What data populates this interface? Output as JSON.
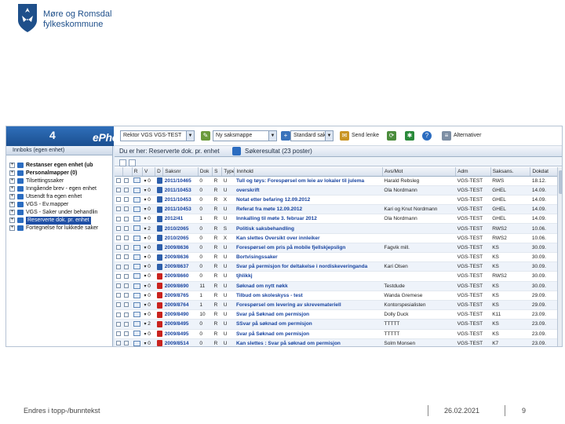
{
  "logo": {
    "line1": "Møre og Romsdal",
    "line2": "fylkeskommune",
    "shield_color": "#1e4f8a"
  },
  "app": {
    "brand": "ePhorte",
    "brand_version": "4",
    "role_value": "Rektor VGS VGS-TEST",
    "folder_value": "Ny saksmappe",
    "template_value": "Standard sak",
    "send_link_label": "Send lenke",
    "alternatives_label": "Alternativer"
  },
  "left_pane": {
    "header": "Innboks (egen enhet)",
    "items": [
      {
        "label": "Restanser egen enhet (ub",
        "bold": true
      },
      {
        "label": "Personalmapper (0)",
        "bold": true
      },
      {
        "label": "Tilsettingssaker",
        "bold": false
      },
      {
        "label": "Inngående brev - egen enhet",
        "bold": false
      },
      {
        "label": "Utsendt fra egen enhet",
        "bold": false
      },
      {
        "label": "VGS - Ev.mapper",
        "bold": false
      },
      {
        "label": "VGS - Saker under behandlin",
        "bold": false
      },
      {
        "label": "Reserverte dok. pr. enhet",
        "bold": false,
        "selected": true
      },
      {
        "label": "Fortegnelse for lukkede saker",
        "bold": false
      }
    ]
  },
  "right_pane": {
    "breadcrumb": "Du er her: Reserverte dok. pr. enhet",
    "search_result": "Søkeresultat (23 poster)",
    "columns": [
      "",
      "",
      "R",
      "V",
      "D",
      "Saksnr",
      "Dok",
      "S",
      "Type",
      "Innhold",
      "Avs/Mot",
      "Adm",
      "Saksans.",
      "Dokdat"
    ],
    "rows": [
      {
        "flag": "0",
        "saksnr": "2011/10465",
        "dok": "0",
        "s": "R",
        "type": "U",
        "innhold": "Tull og tøys: Forespørsel om leie av lokaler til julema",
        "avsmot": "Harald Rebsleg",
        "adm": "VGS-TEST",
        "saksans": "RWS",
        "dokdat": "18.12.",
        "doc": "word"
      },
      {
        "flag": "0",
        "saksnr": "2011/10453",
        "dok": "0",
        "s": "R",
        "type": "U",
        "innhold": "overskrift",
        "avsmot": "Ola Nordmann",
        "adm": "VGS-TEST",
        "saksans": "GHEL",
        "dokdat": "14.09.",
        "doc": "word"
      },
      {
        "flag": "0",
        "saksnr": "2011/10453",
        "dok": "0",
        "s": "R",
        "type": "X",
        "innhold": "Notat etter befaring 12.09.2012",
        "avsmot": "",
        "adm": "VGS-TEST",
        "saksans": "GHEL",
        "dokdat": "14.09.",
        "doc": "word"
      },
      {
        "flag": "0",
        "saksnr": "2011/10453",
        "dok": "0",
        "s": "R",
        "type": "U",
        "innhold": "Referat fra møte 12.09.2012",
        "avsmot": "Kari og Knut Nordmann",
        "adm": "VGS-TEST",
        "saksans": "GHEL",
        "dokdat": "14.09.",
        "doc": "word"
      },
      {
        "flag": "0",
        "saksnr": "2012/41",
        "dok": "1",
        "s": "R",
        "type": "U",
        "innhold": "Innkalling til møte 3. februar 2012",
        "avsmot": "Ola Nordmann",
        "adm": "VGS-TEST",
        "saksans": "GHEL",
        "dokdat": "14.09.",
        "doc": "word"
      },
      {
        "flag": "2",
        "saksnr": "2010/2065",
        "dok": "0",
        "s": "R",
        "type": "S",
        "innhold": "Politisk saksbehandling",
        "avsmot": "",
        "adm": "VGS-TEST",
        "saksans": "RWS2",
        "dokdat": "10.06.",
        "doc": "word"
      },
      {
        "flag": "0",
        "saksnr": "2010/2065",
        "dok": "0",
        "s": "R",
        "type": "X",
        "innhold": "Kan slettes Oversikt over innleiker",
        "avsmot": "",
        "adm": "VGS-TEST",
        "saksans": "RWS2",
        "dokdat": "10.06.",
        "doc": "word"
      },
      {
        "flag": "0",
        "saksnr": "2009/8636",
        "dok": "0",
        "s": "R",
        "type": "U",
        "innhold": "Forespørsel om pris på mobile fjellskjepslign",
        "avsmot": "Fagvik mill.",
        "adm": "VGS-TEST",
        "saksans": "KS",
        "dokdat": "30.09.",
        "doc": "word"
      },
      {
        "flag": "0",
        "saksnr": "2009/8636",
        "dok": "0",
        "s": "R",
        "type": "U",
        "innhold": "Bortvisingssaker",
        "avsmot": "",
        "adm": "VGS-TEST",
        "saksans": "KS",
        "dokdat": "30.09.",
        "doc": "word"
      },
      {
        "flag": "0",
        "saksnr": "2009/8637",
        "dok": "0",
        "s": "R",
        "type": "U",
        "innhold": "Svar på permisjon for deltakelse i nordiskeveringanda",
        "avsmot": "Kari Olsen",
        "adm": "VGS-TEST",
        "saksans": "KS",
        "dokdat": "30.09.",
        "doc": "word"
      },
      {
        "flag": "0",
        "saksnr": "2009/8660",
        "dok": "0",
        "s": "R",
        "type": "U",
        "innhold": "tjhlikkj",
        "avsmot": "",
        "adm": "VGS-TEST",
        "saksans": "RWS2",
        "dokdat": "30.09.",
        "doc": "pdf"
      },
      {
        "flag": "0",
        "saksnr": "2009/8690",
        "dok": "11",
        "s": "R",
        "type": "U",
        "innhold": "Søknad om nytt nøkk",
        "avsmot": "Testdude",
        "adm": "VGS-TEST",
        "saksans": "KS",
        "dokdat": "30.09.",
        "doc": "pdf"
      },
      {
        "flag": "0",
        "saksnr": "2009/8765",
        "dok": "1",
        "s": "R",
        "type": "U",
        "innhold": "Tilbud om skoleskyss - test",
        "avsmot": "Wanda Gremese",
        "adm": "VGS-TEST",
        "saksans": "KS",
        "dokdat": "29.09.",
        "doc": "pdf"
      },
      {
        "flag": "0",
        "saksnr": "2009/8764",
        "dok": "1",
        "s": "R",
        "type": "U",
        "innhold": "Forespørsel om levering av skrevemateriell",
        "avsmot": "Kontorspesialisten",
        "adm": "VGS-TEST",
        "saksans": "KS",
        "dokdat": "29.09.",
        "doc": "pdf"
      },
      {
        "flag": "0",
        "saksnr": "2009/8490",
        "dok": "10",
        "s": "R",
        "type": "U",
        "innhold": "Svar på Søknad om permisjon",
        "avsmot": "Dolly Duck",
        "adm": "VGS-TEST",
        "saksans": "K11",
        "dokdat": "23.09.",
        "doc": "pdf"
      },
      {
        "flag": "2",
        "saksnr": "2009/8495",
        "dok": "0",
        "s": "R",
        "type": "U",
        "innhold": "SSvar på søknad om permisjon",
        "avsmot": "TTTTT",
        "adm": "VGS-TEST",
        "saksans": "KS",
        "dokdat": "23.09.",
        "doc": "pdf"
      },
      {
        "flag": "0",
        "saksnr": "2009/8495",
        "dok": "0",
        "s": "R",
        "type": "U",
        "innhold": "Svar på Søknad om permisjon",
        "avsmot": "TTTTT",
        "adm": "VGS-TEST",
        "saksans": "KS",
        "dokdat": "23.09.",
        "doc": "pdf"
      },
      {
        "flag": "0",
        "saksnr": "2009/8514",
        "dok": "0",
        "s": "R",
        "type": "U",
        "innhold": "Kan slettes : Svar på søknad om permisjon",
        "avsmot": "Solm Monsen",
        "adm": "VGS-TEST",
        "saksans": "K7",
        "dokdat": "23.09.",
        "doc": "pdf"
      }
    ]
  },
  "footer": {
    "left": "Endres i topp-/bunntekst",
    "date": "26.02.2021",
    "page": "9"
  }
}
